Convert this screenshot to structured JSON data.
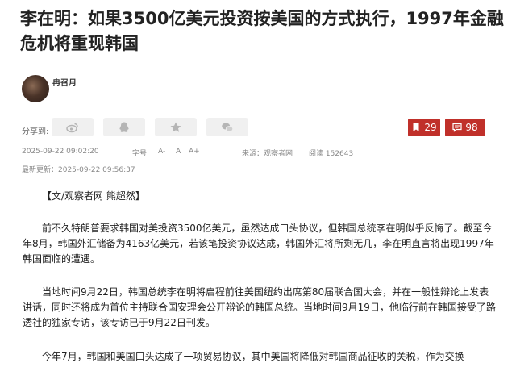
{
  "article": {
    "title": "李在明：如果3500亿美元投资按美国的方式执行，1997年金融危机将重现韩国",
    "author": "冉召月",
    "share_label": "分享到:",
    "favorites_count": "29",
    "comments_count": "98",
    "published": "2025-09-22 09:02:20",
    "font_size_label": "字号:",
    "font_smaller": "A-",
    "font_default": "A",
    "font_larger": "A+",
    "source": "来源：观察者网",
    "views": "阅读 152643",
    "updated": "最新更新：2025-09-22 09:56:37",
    "byline": "【文/观察者网 熊超然】",
    "paragraphs": [
      "前不久特朗普要求韩国对美投资3500亿美元，虽然达成口头协议，但韩国总统李在明似乎反悔了。截至今年8月，韩国外汇储备为4163亿美元，若该笔投资协议达成，韩国外汇将所剩无几，李在明直言将出现1997年韩国面临的遭遇。",
      "当地时间9月22日，韩国总统李在明将启程前往美国纽约出席第80届联合国大会，并在一般性辩论上发表讲话，同时还将成为首位主持联合国安理会公开辩论的韩国总统。当地时间9月19日，他临行前在韩国接受了路透社的独家专访，该专访已于9月22日刊发。",
      "今年7月，韩国和美国口头达成了一项贸易协议，其中美国将降低对韩国商品征收的关税，作为交换"
    ]
  },
  "icons": {
    "share_weibo": "weibo-icon",
    "share_qq": "qq-icon",
    "share_qzone": "star-icon",
    "share_wechat": "wechat-icon",
    "favorite": "bookmark-icon",
    "comment": "comment-icon"
  },
  "colors": {
    "accent": "#c0302a",
    "share_bg": "#f0f0f0",
    "meta_text": "#888888"
  }
}
